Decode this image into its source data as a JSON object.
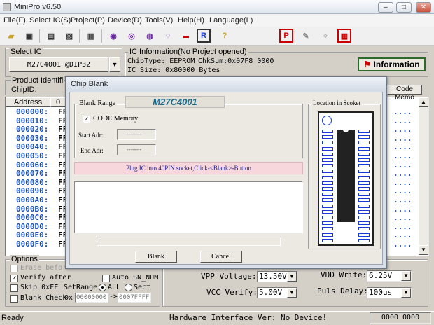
{
  "window": {
    "title": "MiniPro v6.50"
  },
  "menu": [
    "File(F)",
    "Select IC(S)",
    "Project(P)",
    "Device(D)",
    "Tools(V)",
    "Help(H)",
    "Language(L)"
  ],
  "select_ic": {
    "label": "Select IC",
    "value": "M27C4001 @DIP32"
  },
  "ic_info": {
    "label": "IC Information(No Project opened)",
    "chip_type": "ChipType:  EEPROM",
    "checksum": "ChkSum:0x07F8 0000",
    "ic_size": "IC Size:   0x80000 Bytes",
    "info_button": "Information"
  },
  "product": {
    "label": "Product Identifi",
    "chip_id": "ChipID:"
  },
  "table": {
    "addr_header": "Address",
    "col0_header": "0",
    "code_memo": "Code Memo",
    "addresses": [
      "000000:",
      "000010:",
      "000020:",
      "000030:",
      "000040:",
      "000050:",
      "000060:",
      "000070:",
      "000080:",
      "000090:",
      "0000A0:",
      "0000B0:",
      "0000C0:",
      "0000D0:",
      "0000E0:",
      "0000F0:"
    ],
    "cell": "FF",
    "dots": "...."
  },
  "options": {
    "label": "Options",
    "erase_before": "Erase befor",
    "verify_after": "Verify after",
    "auto_sn": "Auto SN_NUM",
    "skip_ff": "Skip 0xFF",
    "set_range": "SetRange:",
    "all": "ALL",
    "sect": "Sect",
    "blank_check": "Blank Check",
    "ox": "0x",
    "range_start": "00000000",
    "arrow": "->",
    "range_end": "0007FFFF"
  },
  "voltages": {
    "vpp_label": "VPP Voltage:",
    "vpp_value": "13.50V",
    "vdd_label": "VDD Write:",
    "vdd_value": "6.25V",
    "vcc_label": "VCC Verify:",
    "vcc_value": "5.00V",
    "puls_label": "Puls Delay:",
    "puls_value": "100us"
  },
  "status": {
    "left": "Ready",
    "hw": "Hardware Interface Ver: No Device!",
    "right": "0000 0000"
  },
  "dialog": {
    "title": "Chip Blank",
    "blank_range": "Blank Range",
    "chip_name": "M27C4001",
    "code_memory": "CODE Memory",
    "start_adr": "Start Adr:",
    "end_adr": "End Adr:",
    "start_val": "--------",
    "end_val": "--------",
    "message": "Plug IC into 40PIN socket,Click-<Blank>-Button",
    "location": "Location in Scoket",
    "blank_button": "Blank",
    "cancel_button": "Cancel"
  },
  "colors": {
    "accent": "#1a4fb0",
    "chip_name": "#1e6b8a",
    "message_bg": "#f7d7dc",
    "socket_blue": "#1a3bd6"
  }
}
